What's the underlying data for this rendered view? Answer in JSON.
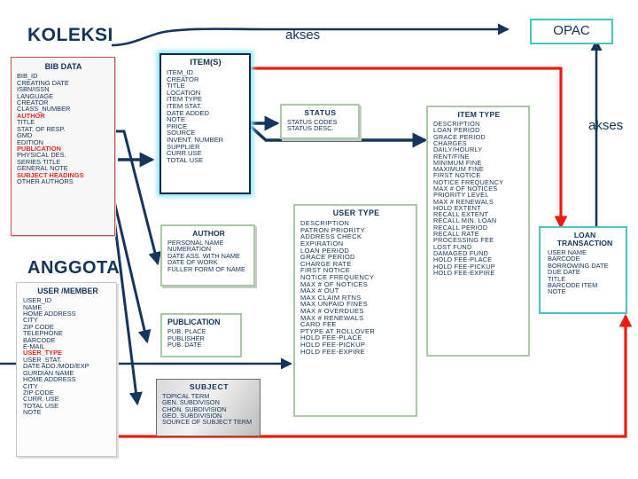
{
  "diagram": {
    "title_left": "KOLEKSI",
    "title_left2": "ANGGOTA",
    "flow_label_top": "akses",
    "flow_label_right": "akses",
    "opac_label": "OPAC",
    "colors": {
      "text": "#12335c",
      "highlight": "#e8291c",
      "red_flow": "#ee1b11",
      "navy_flow": "#16355e",
      "cyan_glow": "#8fe6f5",
      "green_border": "#a9c9a4",
      "teal_border": "#49c3c9"
    }
  },
  "entities": [
    {
      "id": "bib-data",
      "title": "BIB DATA",
      "fields": [
        {
          "t": "BIB_ID"
        },
        {
          "t": "CREATING DATE"
        },
        {
          "t": "ISBN/ISSN"
        },
        {
          "t": "LANGUAGE"
        },
        {
          "t": "CREATOR"
        },
        {
          "t": "CLASS_NUMBER"
        },
        {
          "t": "AUTHOR",
          "hl": true
        },
        {
          "t": "TITLE"
        },
        {
          "t": "STAT. OF RESP."
        },
        {
          "t": "GMD"
        },
        {
          "t": "EDITION"
        },
        {
          "t": "PUBLICATION",
          "hl": true
        },
        {
          "t": "PHYSICAL DES."
        },
        {
          "t": "SERIES TITLE"
        },
        {
          "t": "GENERAL NOTE"
        },
        {
          "t": "SUBJECT HEADINGS",
          "hl": true
        },
        {
          "t": "OTHER  AUTHORS"
        }
      ]
    },
    {
      "id": "items",
      "title": "ITEM(S)",
      "fields": [
        {
          "t": "ITEM_ID"
        },
        {
          "t": "CREATOR"
        },
        {
          "t": "TITLE"
        },
        {
          "t": "LOCATION"
        },
        {
          "t": "ITEM TYPE"
        },
        {
          "t": "ITEM STAT."
        },
        {
          "t": "DATE ADDED"
        },
        {
          "t": "NOTE"
        },
        {
          "t": "PRICE"
        },
        {
          "t": "SOURCE"
        },
        {
          "t": "INVENT. NUMBER"
        },
        {
          "t": "SUPPLIER"
        },
        {
          "t": "CURR.USE"
        },
        {
          "t": "TOTAL USE"
        }
      ]
    },
    {
      "id": "status",
      "title": "STATUS",
      "fields": [
        {
          "t": "STATUS CODES"
        },
        {
          "t": "STATUS DESC."
        }
      ]
    },
    {
      "id": "item-type",
      "title": "ITEM TYPE",
      "fields": [
        {
          "t": "DESCRIPTION"
        },
        {
          "t": "LOAN PERIOD"
        },
        {
          "t": "GRACE PERIOD"
        },
        {
          "t": "CHARGES"
        },
        {
          "t": "DAILY/HOURLY"
        },
        {
          "t": "RENT/FINE"
        },
        {
          "t": "MINIMUM FINE"
        },
        {
          "t": "MAXIMUM FINE"
        },
        {
          "t": "FIRST NOTICE"
        },
        {
          "t": "NOTICE FREQUENCY"
        },
        {
          "t": "MAX # OF NOTICES"
        },
        {
          "t": "PRIORITY LEVEL"
        },
        {
          "t": "MAX # RENEWALS"
        },
        {
          "t": "HOLD EXTENT"
        },
        {
          "t": "RECALL EXTENT"
        },
        {
          "t": "RECALL MIN. LOAN"
        },
        {
          "t": "RECALL PERIOD"
        },
        {
          "t": "RECALL RATE"
        },
        {
          "t": "PROCESSING FEE"
        },
        {
          "t": "LOST FUND"
        },
        {
          "t": "DAMAGED FUND"
        },
        {
          "t": "HOLD FEE-PLACE"
        },
        {
          "t": "HOLD FEE-PICKUP"
        },
        {
          "t": "HOLD FEE-EXPIRE"
        }
      ]
    },
    {
      "id": "author",
      "title": "AUTHOR",
      "fields": [
        {
          "t": "PERSONAL NAME"
        },
        {
          "t": "NUMERATION"
        },
        {
          "t": "DATE ASS. WITH NAME"
        },
        {
          "t": "DATE OF WORK"
        },
        {
          "t": "FULLER FORM OF NAME"
        }
      ]
    },
    {
      "id": "publication",
      "title": "PUBLICATION",
      "fields": [
        {
          "t": "PUB. PLACE"
        },
        {
          "t": "PUBLISHER"
        },
        {
          "t": "PUB. DATE"
        }
      ]
    },
    {
      "id": "subject",
      "title": "SUBJECT",
      "fields": [
        {
          "t": "TOPICAL TERM"
        },
        {
          "t": "GEN. SUBDIVISON"
        },
        {
          "t": "CHON. SUBDIVISION"
        },
        {
          "t": "GEO. SUBDIVISION"
        },
        {
          "t": "SOURCE OF  SUBJECT TERM"
        }
      ]
    },
    {
      "id": "user-type",
      "title": "USER TYPE",
      "fields": [
        {
          "t": "DESCRIPTION"
        },
        {
          "t": "PATRON PRIORITY"
        },
        {
          "t": "ADDRESS CHECK"
        },
        {
          "t": "EXPIRATION"
        },
        {
          "t": "LOAN PERIOD"
        },
        {
          "t": "GRACE PERIOD"
        },
        {
          "t": "CHARGE RATE"
        },
        {
          "t": "FIRST NOTICE"
        },
        {
          "t": "NOTICE FREQUENCY"
        },
        {
          "t": "MAX # OF NOTICES"
        },
        {
          "t": "MAX # OUT"
        },
        {
          "t": "MAX CLAIM RTNS"
        },
        {
          "t": "MAX UNPAID FINES"
        },
        {
          "t": "MAX # OVERDUES"
        },
        {
          "t": "MAX # RENEWALS"
        },
        {
          "t": "CARD FEE"
        },
        {
          "t": "PTYPE AT ROLLOVER"
        },
        {
          "t": "HOLD FEE-PLACE"
        },
        {
          "t": "HOLD FEE-PICKUP"
        },
        {
          "t": "HOLD FEE-EXPIRE"
        }
      ]
    },
    {
      "id": "loan-transaction",
      "title": "LOAN\nTRANSACTION",
      "fields": [
        {
          "t": "USER NAME"
        },
        {
          "t": "BARCODE"
        },
        {
          "t": "BORROWING DATE"
        },
        {
          "t": "DUE DATE"
        },
        {
          "t": "TITLE"
        },
        {
          "t": "BARCODE ITEM"
        },
        {
          "t": "NOTE"
        }
      ]
    },
    {
      "id": "user-member",
      "title": "USER /MEMBER",
      "fields": [
        {
          "t": "USER_ID"
        },
        {
          "t": "NAME"
        },
        {
          "t": "HOME ADDRESS"
        },
        {
          "t": "CITY"
        },
        {
          "t": "ZIP CODE"
        },
        {
          "t": "TELEPHONE"
        },
        {
          "t": "BARCODE"
        },
        {
          "t": "E-MAIL"
        },
        {
          "t": "USER_TYPE",
          "hl": true
        },
        {
          "t": "USER_STAT."
        },
        {
          "t": "DATE ADD./MOD/EXP"
        },
        {
          "t": "GURDIAN NAME"
        },
        {
          "t": "HOME ADDRESS"
        },
        {
          "t": "CITY"
        },
        {
          "t": "ZIP CODE"
        },
        {
          "t": "CURR. USE"
        },
        {
          "t": "TOTAL USE"
        },
        {
          "t": "NOTE"
        }
      ]
    }
  ]
}
